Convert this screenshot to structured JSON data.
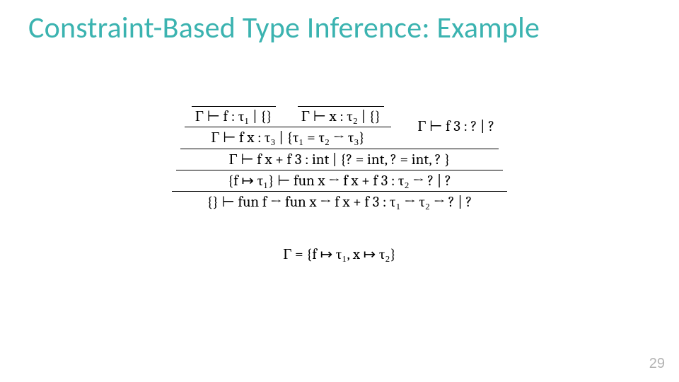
{
  "title": "Constraint-Based Type Inference: Example",
  "tree": {
    "leaf_f": "Γ ⊢ f : τ₁ | {}",
    "leaf_x": "Γ ⊢ x : τ₂ | {}",
    "app_fx": "Γ ⊢ f x : τ₃ | {τ₁ = τ₂ → τ₃}",
    "app_f3": "Γ ⊢ f 3 : ? | ?",
    "plus": "Γ ⊢ f x + f 3 : int | {? = int, ? = int, ? }",
    "fun_x": "{f ↦ τ₁} ⊢ fun x → f x + f 3 : τ₂ → ? | ?",
    "fun_f": "{} ⊢ fun f → fun x → f x + f 3 : τ₁ → τ₂ → ? | ?"
  },
  "gamma": "Γ = {f ↦ τ₁, x ↦ τ₂}",
  "page_number": "29"
}
